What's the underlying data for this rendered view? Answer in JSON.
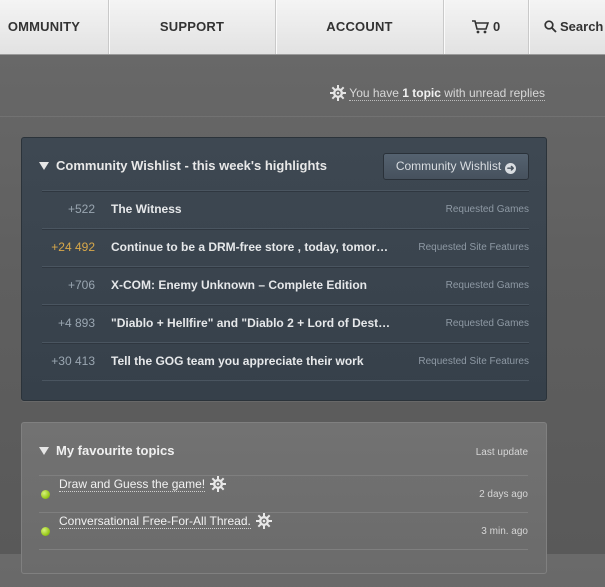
{
  "nav": {
    "items": [
      {
        "label": "OMMUNITY"
      },
      {
        "label": "SUPPORT"
      },
      {
        "label": "ACCOUNT"
      }
    ],
    "cart_count": "0",
    "search_label": "Search"
  },
  "notice": {
    "prefix": "You have",
    "count": "1 topic",
    "suffix": "with unread replies"
  },
  "wishlist": {
    "title": "Community Wishlist - this week's highlights",
    "button_label": "Community Wishlist",
    "rows": [
      {
        "score": "+522",
        "title": "The Witness",
        "category": "Requested Games",
        "highlight": false
      },
      {
        "score": "+24 492",
        "title": "Continue to be a DRM-free store , today, tomor…",
        "category": "Requested Site Features",
        "highlight": true
      },
      {
        "score": "+706",
        "title": "X-COM: Enemy Unknown – Complete Edition",
        "category": "Requested Games",
        "highlight": false
      },
      {
        "score": "+4 893",
        "title": "\"Diablo + Hellfire\" and \"Diablo 2 + Lord of Dest…",
        "category": "Requested Games",
        "highlight": false
      },
      {
        "score": "+30 413",
        "title": "Tell the GOG team you appreciate their work",
        "category": "Requested Site Features",
        "highlight": false
      }
    ]
  },
  "favourites": {
    "title": "My favourite topics",
    "last_update_label": "Last update",
    "rows": [
      {
        "title": "Draw and Guess the game!",
        "ago": "2 days ago"
      },
      {
        "title": "Conversational Free-For-All Thread.",
        "ago": "3 min. ago"
      }
    ]
  },
  "colors": {
    "score_highlight": "#d8a84a",
    "online_dot": "#9acb1d"
  }
}
